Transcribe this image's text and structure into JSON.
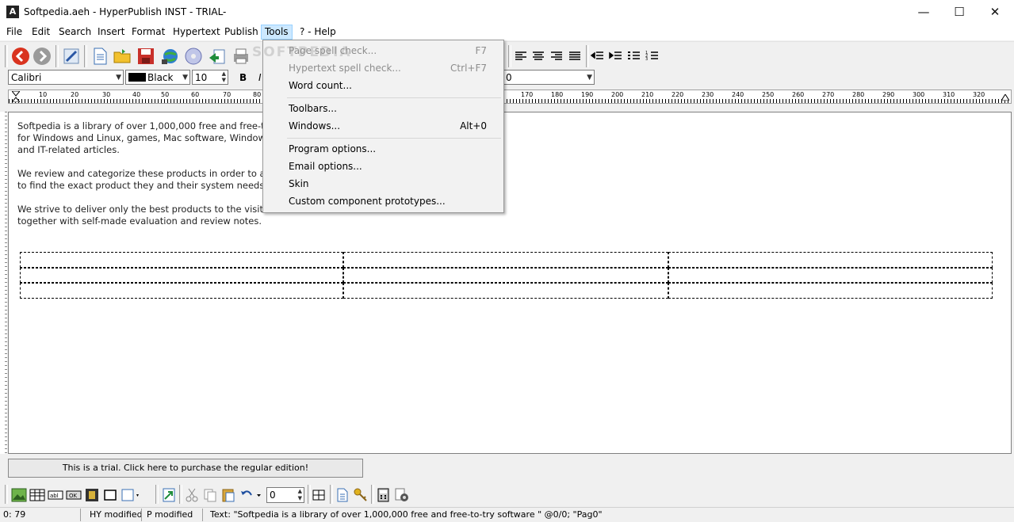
{
  "window": {
    "title": "Softpedia.aeh - HyperPublish INST - TRIAL-",
    "app_icon_glyph": "A",
    "minimize_glyph": "—",
    "maximize_glyph": "☐",
    "close_glyph": "✕"
  },
  "menubar": [
    "File",
    "Edit",
    "Search",
    "Insert",
    "Format",
    "Hypertext",
    "Publish",
    "Tools",
    "? - Help"
  ],
  "tools_menu": {
    "items": [
      {
        "label": "Page spell check...",
        "shortcut": "F7",
        "disabled": true
      },
      {
        "label": "Hypertext spell check...",
        "shortcut": "Ctrl+F7",
        "disabled": true
      },
      {
        "label": "Word count...",
        "shortcut": "",
        "disabled": false
      },
      {
        "label": "Toolbars...",
        "shortcut": "",
        "disabled": false
      },
      {
        "label": "Windows...",
        "shortcut": "Alt+0",
        "disabled": false
      },
      {
        "label": "Program options...",
        "shortcut": "",
        "disabled": false
      },
      {
        "label": "Email options...",
        "shortcut": "",
        "disabled": false
      },
      {
        "label": "Skin",
        "shortcut": "",
        "disabled": false
      },
      {
        "label": "Custom component prototypes...",
        "shortcut": "",
        "disabled": false
      }
    ]
  },
  "format_bar": {
    "font": "Calibri",
    "color": "Black",
    "size": "10",
    "bold": "B",
    "italic": "I",
    "right_combo": "0",
    "color_swatch": "#000000"
  },
  "ruler_labels": [
    "10",
    "20",
    "30",
    "40",
    "50",
    "60",
    "70",
    "80",
    "170",
    "180",
    "190",
    "200",
    "210",
    "220",
    "230",
    "240",
    "250",
    "260",
    "270",
    "280",
    "290",
    "300",
    "310",
    "320"
  ],
  "document": {
    "paragraphs": [
      [
        "Softpedia is a library of over 1,000,000 free and free-to-",
        "for Windows and Linux, games, Mac software, Windows",
        "and IT-related articles."
      ],
      [
        "We review and categorize these products in order to allo",
        "to find the exact product they and their system needs."
      ],
      [
        "We strive to deliver only the best products to the visitor,",
        "together with self-made evaluation and review notes."
      ]
    ]
  },
  "trial_button": "This is a trial. Click here to purchase the regular edition!",
  "bottom_toolbar": {
    "stepper_value": "0"
  },
  "statusbar": {
    "position": "0: 79",
    "hy": "HY modified",
    "p": "P modified",
    "text": "Text: \"Softpedia is a library of over 1,000,000 free and free-to-try software \" @0/0; \"Pag0\""
  },
  "watermark": "SOFTPEDIA"
}
